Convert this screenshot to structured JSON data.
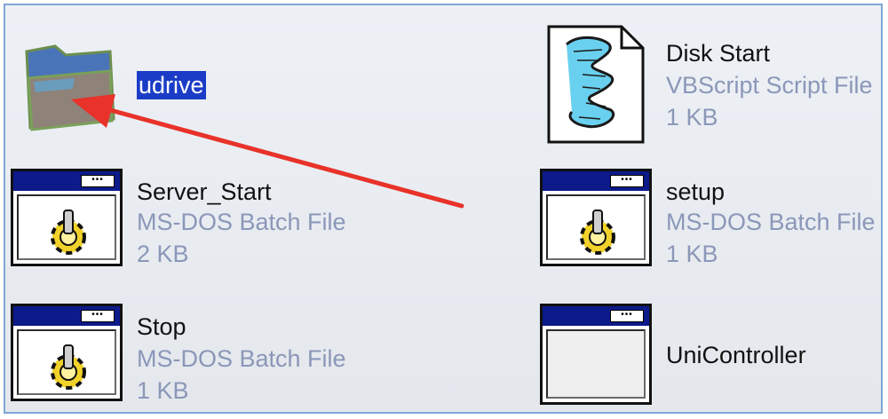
{
  "items": [
    {
      "name": "udrive",
      "icon": "folder-icon",
      "selected": true
    },
    {
      "name": "Disk Start",
      "type": "VBScript Script File",
      "size": "1 KB",
      "icon": "vbscript-file-icon"
    },
    {
      "name": "Server_Start",
      "type": "MS-DOS Batch File",
      "size": "2 KB",
      "icon": "batch-file-icon"
    },
    {
      "name": "setup",
      "type": "MS-DOS Batch File",
      "size": "1 KB",
      "icon": "batch-file-icon"
    },
    {
      "name": "Stop",
      "type": "MS-DOS Batch File",
      "size": "1 KB",
      "icon": "batch-file-icon"
    },
    {
      "name": "UniController",
      "icon": "application-window-icon"
    }
  ],
  "annotation": {
    "color": "#e8322a",
    "points_to": "udrive"
  },
  "colors": {
    "selection": "#1a3cc6",
    "detail_text": "#8b97b8",
    "window_titlebar": "#0d1a8a"
  }
}
